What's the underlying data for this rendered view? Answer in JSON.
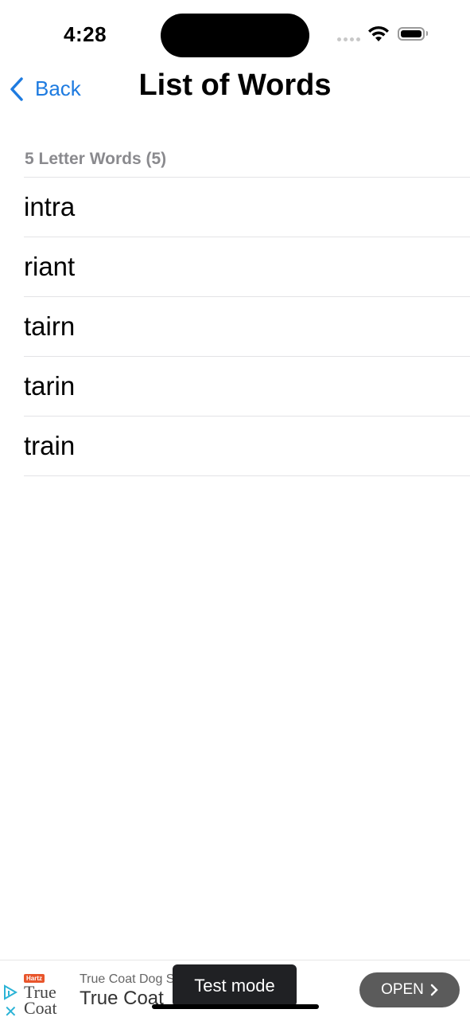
{
  "status_bar": {
    "time": "4:28",
    "icons": [
      "cellular-signal-icon",
      "wifi-icon",
      "battery-icon"
    ]
  },
  "nav": {
    "back_label": "Back",
    "title": "List of Words"
  },
  "section": {
    "header": "5 Letter Words (5)",
    "words": [
      "intra",
      "riant",
      "tairn",
      "tarin",
      "train"
    ]
  },
  "ad": {
    "logo_badge": "Hartz",
    "logo_line1": "True",
    "logo_line2": "Coat",
    "headline_small": "True Coat Dog S",
    "headline_large": "True Coat",
    "open_label": "OPEN",
    "toast": "Test mode"
  },
  "colors": {
    "accent": "#1e7be0",
    "section_header": "#8a8a8e",
    "separator": "#e3e3e6",
    "ad_button": "#5b5b5b",
    "ad_choices": "#2bb3d6"
  }
}
